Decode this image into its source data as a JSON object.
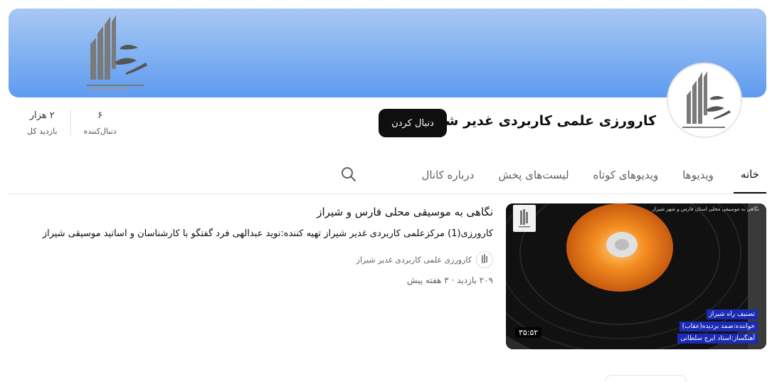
{
  "channel": {
    "title": "کارورزی علمی کاربردی غدیر شیراز",
    "follow_label": "دنبال کردن",
    "brand_colors": {
      "banner_top": "#a9c8f3",
      "banner_bottom": "#5f9bf0",
      "button": "#0f0f0f"
    }
  },
  "stats": [
    {
      "value": "۲ هزار",
      "label": "بازدید کل"
    },
    {
      "value": "۶",
      "label": "دنبال‌کننده"
    }
  ],
  "tabs": [
    {
      "label": "خانه",
      "active": true
    },
    {
      "label": "ویدیوها",
      "active": false
    },
    {
      "label": "ویدیوهای کوتاه",
      "active": false
    },
    {
      "label": "لیست‌های پخش",
      "active": false
    },
    {
      "label": "درباره کانال",
      "active": false
    }
  ],
  "video": {
    "title": "نگاهی به موسیقی محلی فارس و شیراز",
    "description": "کارورزی(1) مرکزعلمی کاربردی غدیر شیراز تهیه کننده:نوید عبدالهی فرد گفتگو با کارشناسان و اساتید موسیقی شیراز",
    "channel_name": "کارورزی علمی کاربردی غدیر شیراز",
    "meta": "۲۰۹ بازدید · ۳ هفته پیش",
    "duration": "۳۵:۵۲",
    "thumb_caption": "نگاهی به موسیقی محلی استان فارس و شهر شیراز",
    "thumb_credits": [
      "تصنیف راه شیراز",
      "خواننده:صمد بردیده(عقاب)",
      "آهنگساز:استاد ایرج سلطانی"
    ]
  },
  "icons": {
    "search": "search-icon",
    "logo": "logo-icon"
  }
}
